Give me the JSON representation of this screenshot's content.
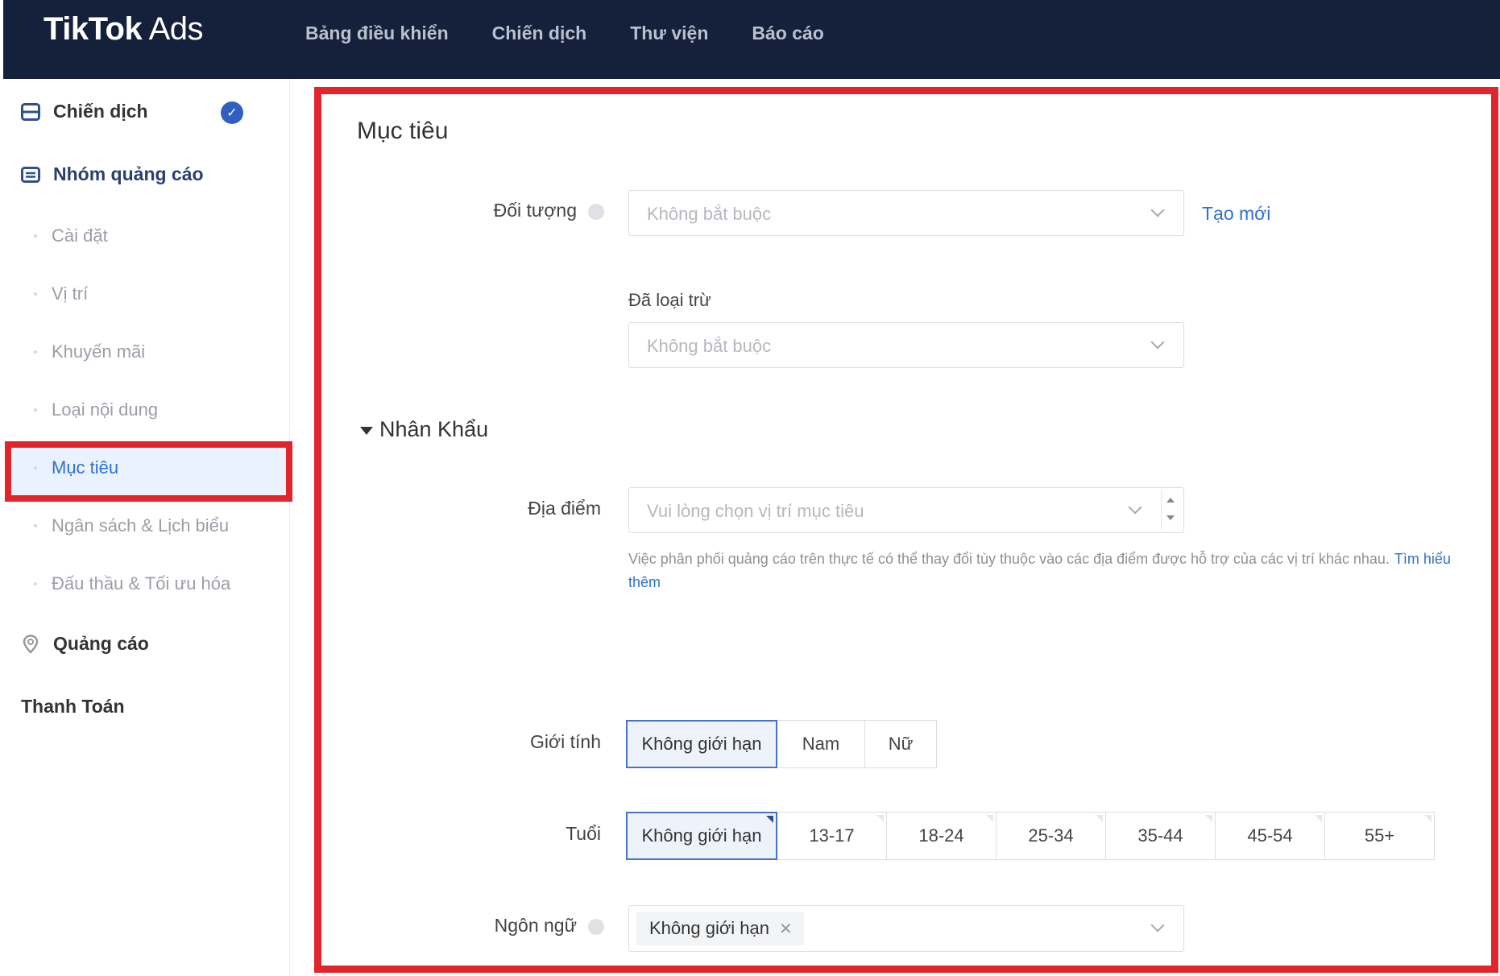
{
  "app": {
    "logo_bold": "TikTok",
    "logo_light": " Ads"
  },
  "topnav": [
    "Bảng điều khiển",
    "Chiến dịch",
    "Thư viện",
    "Báo cáo"
  ],
  "sidebar": {
    "campaign": "Chiến dịch",
    "adgroup": "Nhóm quảng cáo",
    "sub": [
      "Cài đặt",
      "Vị trí",
      "Khuyến mãi",
      "Loại nội dung",
      "Mục tiêu",
      "Ngân sách & Lịch biểu",
      "Đấu thầu & Tối ưu hóa"
    ],
    "ads": "Quảng cáo",
    "payment": "Thanh Toán"
  },
  "main": {
    "title": "Mục tiêu",
    "audience": {
      "label": "Đối tượng",
      "placeholder": "Không bắt buộc",
      "create_link": "Tạo mới"
    },
    "excluded": {
      "label": "Đã loại trừ",
      "placeholder": "Không bắt buộc"
    },
    "demographics": "Nhân Khẩu",
    "location": {
      "label": "Địa điểm",
      "placeholder": "Vui lòng chọn vị trí mục tiêu",
      "help": "Việc phân phối quảng cáo trên thực tế có thể thay đổi tùy thuộc vào các địa điểm được hỗ trợ của các vị trí khác nhau.",
      "learn_more": "Tìm hiểu thêm"
    },
    "gender": {
      "label": "Giới tính",
      "options": [
        "Không giới hạn",
        "Nam",
        "Nữ"
      ]
    },
    "age": {
      "label": "Tuổi",
      "options": [
        "Không giới hạn",
        "13-17",
        "18-24",
        "25-34",
        "35-44",
        "45-54",
        "55+"
      ]
    },
    "language": {
      "label": "Ngôn ngữ",
      "tag": "Không giới hạn"
    }
  }
}
